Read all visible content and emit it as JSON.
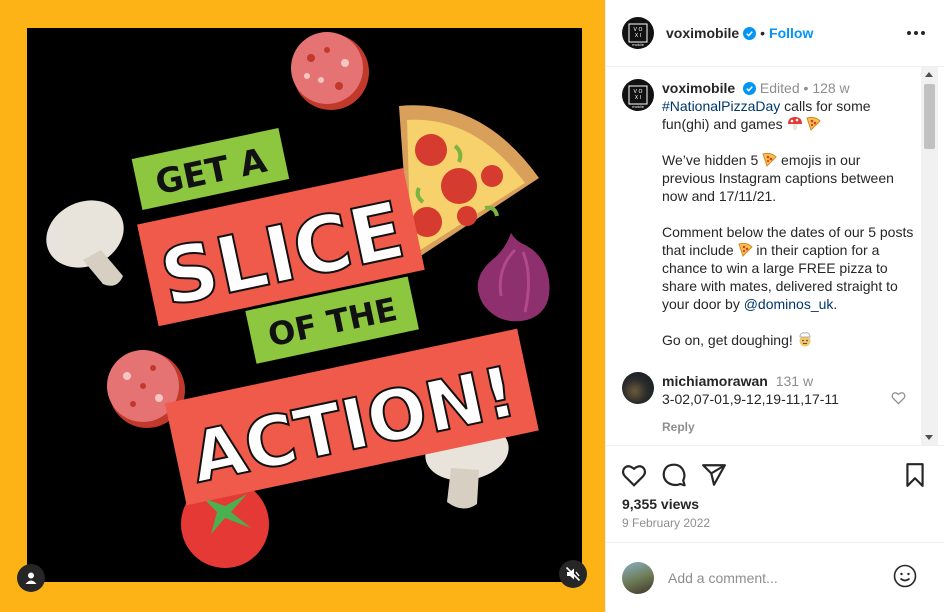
{
  "account": {
    "username": "voximobile",
    "follow_label": "Follow",
    "logo_text_top": "V O",
    "logo_text_mid": "X I",
    "logo_text_bottom": "mobile"
  },
  "artwork": {
    "line1": "GET A",
    "line2": "SLICE",
    "line3": "OF THE",
    "line4": "ACTION!",
    "colors": {
      "frame": "#fdb316",
      "background": "#000000",
      "red_banner": "#ef5a4a",
      "green_banner": "#8dc63f"
    }
  },
  "caption": {
    "username": "voximobile",
    "edited": "Edited",
    "separator": "•",
    "age": "128 w",
    "hashtag": "#NationalPizzaDay",
    "text1": " calls for some fun(ghi) and games ",
    "p2a": "We’ve hidden 5 ",
    "p2b": " emojis in our previous Instagram captions between now and 17/11/21.",
    "p3a": "Comment below the dates of our 5 posts that include ",
    "p3b": " in their caption for a chance to win a large FREE pizza to share with mates, delivered straight to your door by ",
    "mention": "@dominos_uk",
    "p3c": ".",
    "p4": "Go on, get doughing! "
  },
  "comment": {
    "username": "michiamorawan",
    "age": "131 w",
    "text": "3-02,07-01,9-12,19-11,17-11",
    "reply_label": "Reply"
  },
  "stats": {
    "views": "9,355 views",
    "date": "9 February 2022"
  },
  "add_comment": {
    "placeholder": "Add a comment..."
  },
  "icons": [
    "verified-icon",
    "more-options-icon",
    "mushroom-icon",
    "pizza-icon",
    "cook-icon",
    "heart-icon",
    "comment-icon",
    "share-icon",
    "bookmark-icon",
    "emoji-icon",
    "user-tag-icon",
    "mute-icon"
  ],
  "colors": {
    "link": "#0095f6",
    "hashtag": "#00376b",
    "muted": "#8e8e8e",
    "text": "#262626"
  }
}
